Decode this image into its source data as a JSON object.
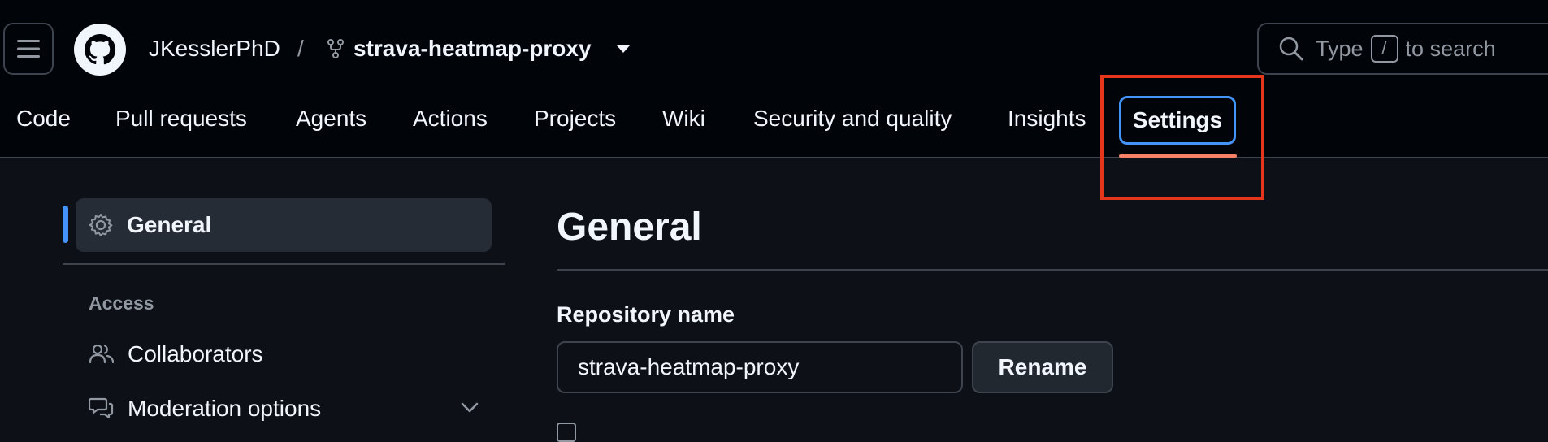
{
  "header": {
    "owner": "JKesslerPhD",
    "separator": "/",
    "repo": "strava-heatmap-proxy",
    "search": {
      "prefix": "Type",
      "key": "/",
      "suffix": "to search"
    }
  },
  "tabs": [
    {
      "label": "Code"
    },
    {
      "label": "Pull requests"
    },
    {
      "label": "Agents"
    },
    {
      "label": "Actions"
    },
    {
      "label": "Projects"
    },
    {
      "label": "Wiki"
    },
    {
      "label": "Security and quality"
    },
    {
      "label": "Insights"
    },
    {
      "label": "Settings",
      "active": true
    }
  ],
  "sidebar": {
    "active_item": "General",
    "section_heading": "Access",
    "items": [
      {
        "label": "Collaborators",
        "icon": "people-icon"
      },
      {
        "label": "Moderation options",
        "icon": "comment-discussion-icon",
        "expandable": true
      }
    ]
  },
  "main": {
    "title": "General",
    "repo_name_label": "Repository name",
    "repo_name_value": "strava-heatmap-proxy",
    "rename_label": "Rename"
  },
  "colors": {
    "header_bg": "#010409",
    "page_bg": "#0d1117",
    "accent": "#4493f8",
    "tab_underline": "#f78166",
    "highlight_box": "#e5361b"
  }
}
